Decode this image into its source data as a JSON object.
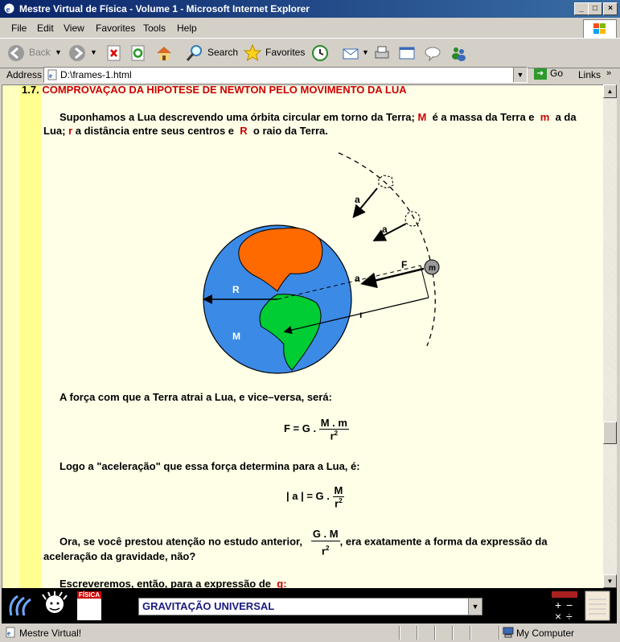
{
  "window": {
    "title": "Mestre Virtual de Física - Volume 1 - Microsoft Internet Explorer"
  },
  "menu": [
    "File",
    "Edit",
    "View",
    "Favorites",
    "Tools",
    "Help"
  ],
  "toolbar": {
    "back": "Back",
    "search": "Search",
    "favorites": "Favorites"
  },
  "address": {
    "label": "Address",
    "value": "D:\\frames-1.html",
    "go": "Go",
    "links": "Links"
  },
  "content": {
    "heading_num": "1.7.",
    "heading": "COMPROVAÇÃO DA HIPÓTESE DE NEWTON PELO MOVIMENTO DA LUA",
    "para1": {
      "a": "Suponhamos a Lua descrevendo uma órbita circular em torno da Terra;",
      "M": "M",
      "b": "é a massa da Terra e",
      "m": "m",
      "c": "a da",
      "d": "Lua;",
      "r": "r",
      "e": "a distância entre seus centros e",
      "R": "R",
      "f": "o raio da Terra."
    },
    "figure": {
      "label_a": "a",
      "label_F": "F",
      "label_m": "m",
      "label_R": "R",
      "label_r": "r",
      "label_M": "M"
    },
    "para2": "A força com que a Terra atrai a Lua, e vice–versa, será:",
    "formula1": {
      "lhs": "F  =  G .",
      "num": "M . m",
      "den": "r",
      "exp": "2"
    },
    "para3": "Logo a \"aceleração\" que essa força determina para a Lua, é:",
    "formula2": {
      "lhs": "| a |  =  G .",
      "num": "M",
      "den": "r",
      "exp": "2"
    },
    "para4a": "Ora, se você prestou atenção no estudo anterior,",
    "formula3": {
      "num": "G . M",
      "den": "r",
      "exp": "2"
    },
    "para4b": ",   era exatamente a forma da expressão da",
    "para4c": "aceleração da gravidade, não?",
    "para5": "Escreveremos, então, para a expressão de",
    "para5g": "g:"
  },
  "nav": {
    "selected": "GRAVITAÇÃO UNIVERSAL",
    "badge_fisica": "FÍSICA"
  },
  "status": {
    "text": "Mestre Virtual!",
    "zone": "My Computer"
  },
  "colors": {
    "title_start": "#0a246a",
    "title_end": "#3a6ea5",
    "accent_red": "#cc0000",
    "earth_blue": "#3b8ae6",
    "land_orange": "#ff6a00",
    "land_green": "#00cc33"
  }
}
